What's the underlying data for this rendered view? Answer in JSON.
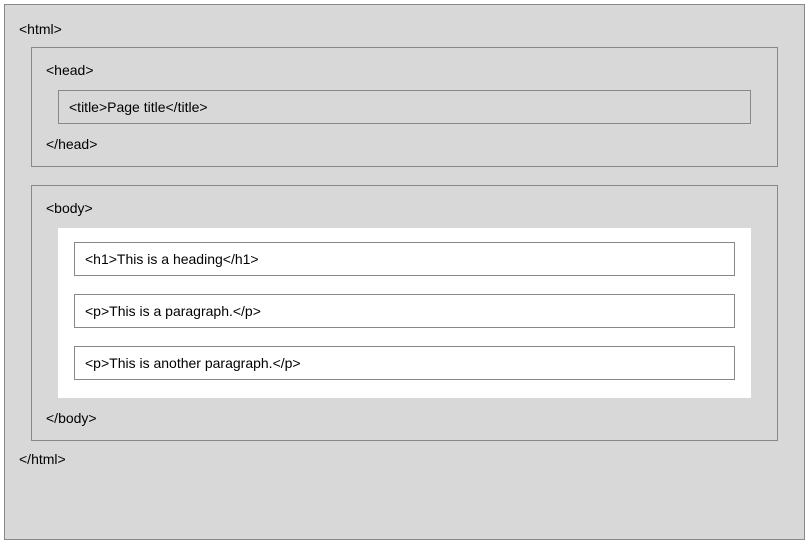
{
  "html": {
    "open": "<html>",
    "close": "</html>",
    "head": {
      "open": "<head>",
      "close": "</head>",
      "title": "<title>Page title</title>"
    },
    "body": {
      "open": "<body>",
      "close": "</body>",
      "h1": "<h1>This is a heading</h1>",
      "p1": "<p>This is a paragraph.</p>",
      "p2": "<p>This is another paragraph.</p>"
    }
  }
}
